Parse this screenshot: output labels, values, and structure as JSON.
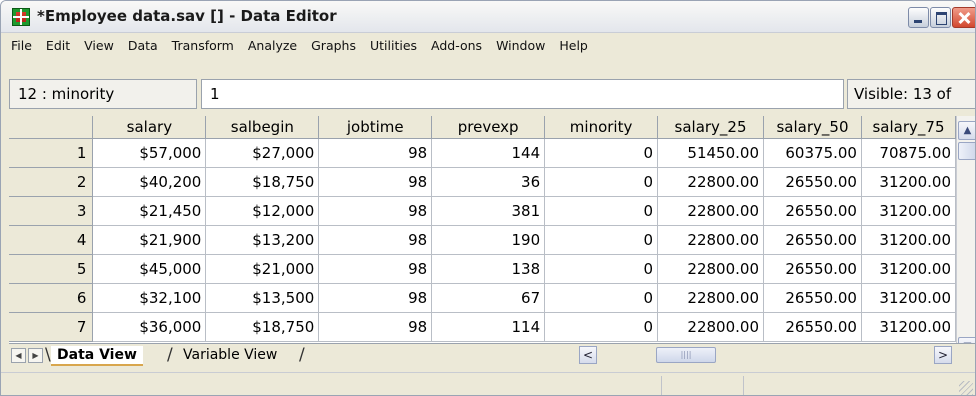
{
  "window": {
    "title": "*Employee data.sav [] - Data Editor",
    "accent": "#1f9a2e"
  },
  "menu": [
    "File",
    "Edit",
    "View",
    "Data",
    "Transform",
    "Analyze",
    "Graphs",
    "Utilities",
    "Add-ons",
    "Window",
    "Help"
  ],
  "cell_editor": {
    "reference": "12 : minority",
    "value": "1",
    "visible": "Visible: 13 of"
  },
  "grid": {
    "columns": [
      "salary",
      "salbegin",
      "jobtime",
      "prevexp",
      "minority",
      "salary_25",
      "salary_50",
      "salary_75"
    ],
    "rows": [
      {
        "num": "1",
        "cells": [
          "$57,000",
          "$27,000",
          "98",
          "144",
          "0",
          "51450.00",
          "60375.00",
          "70875.00"
        ]
      },
      {
        "num": "2",
        "cells": [
          "$40,200",
          "$18,750",
          "98",
          "36",
          "0",
          "22800.00",
          "26550.00",
          "31200.00"
        ]
      },
      {
        "num": "3",
        "cells": [
          "$21,450",
          "$12,000",
          "98",
          "381",
          "0",
          "22800.00",
          "26550.00",
          "31200.00"
        ]
      },
      {
        "num": "4",
        "cells": [
          "$21,900",
          "$13,200",
          "98",
          "190",
          "0",
          "22800.00",
          "26550.00",
          "31200.00"
        ]
      },
      {
        "num": "5",
        "cells": [
          "$45,000",
          "$21,000",
          "98",
          "138",
          "0",
          "22800.00",
          "26550.00",
          "31200.00"
        ]
      },
      {
        "num": "6",
        "cells": [
          "$32,100",
          "$13,500",
          "98",
          "67",
          "0",
          "22800.00",
          "26550.00",
          "31200.00"
        ]
      },
      {
        "num": "7",
        "cells": [
          "$36,000",
          "$18,750",
          "98",
          "114",
          "0",
          "22800.00",
          "26550.00",
          "31200.00"
        ]
      }
    ]
  },
  "tabs": {
    "data_view": "Data View",
    "variable_view": "Variable View"
  },
  "icons": {
    "scroll_up": "scroll-up-icon",
    "scroll_down": "scroll-down-icon",
    "scroll_left": "scroll-left-icon",
    "scroll_right": "scroll-right-icon"
  }
}
